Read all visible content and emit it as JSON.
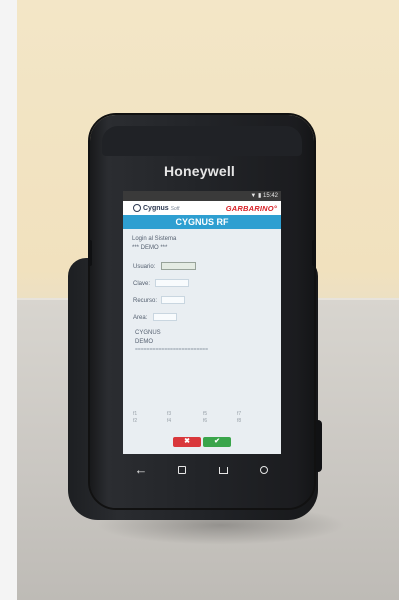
{
  "device": {
    "brand": "Honeywell"
  },
  "statusbar": {
    "icons": "▼ ▮",
    "time": "15:42"
  },
  "logos": {
    "cygnus": "Cygnus",
    "cygnus_suffix": "Soft",
    "garbarino": "GARBARINO°"
  },
  "app": {
    "title": "CYGNUS RF"
  },
  "content": {
    "line1": "Login al Sistema",
    "line2": "*** DEMO ***",
    "fields": [
      {
        "label": "Usuario:",
        "value": ""
      },
      {
        "label": "Clave:",
        "value": ""
      },
      {
        "label": "Recurso:",
        "value": ""
      },
      {
        "label": "Area:",
        "value": ""
      }
    ],
    "info1": "CYGNUS",
    "info2": "DEMO",
    "separator": "========================="
  },
  "footer": {
    "cells": [
      "f1",
      "f3",
      "f5",
      "f7",
      "f2",
      "f4",
      "f6",
      "f8"
    ]
  },
  "buttons": {
    "cancel": "✖",
    "ok": "✔"
  },
  "colors": {
    "title_bar": "#2e9fd1",
    "cancel": "#d9373b",
    "ok": "#3aa54b",
    "garbarino": "#d71f25"
  },
  "icons": {
    "back": "back-icon",
    "recent": "recent-apps-icon",
    "home": "home-icon",
    "search": "search-icon"
  }
}
